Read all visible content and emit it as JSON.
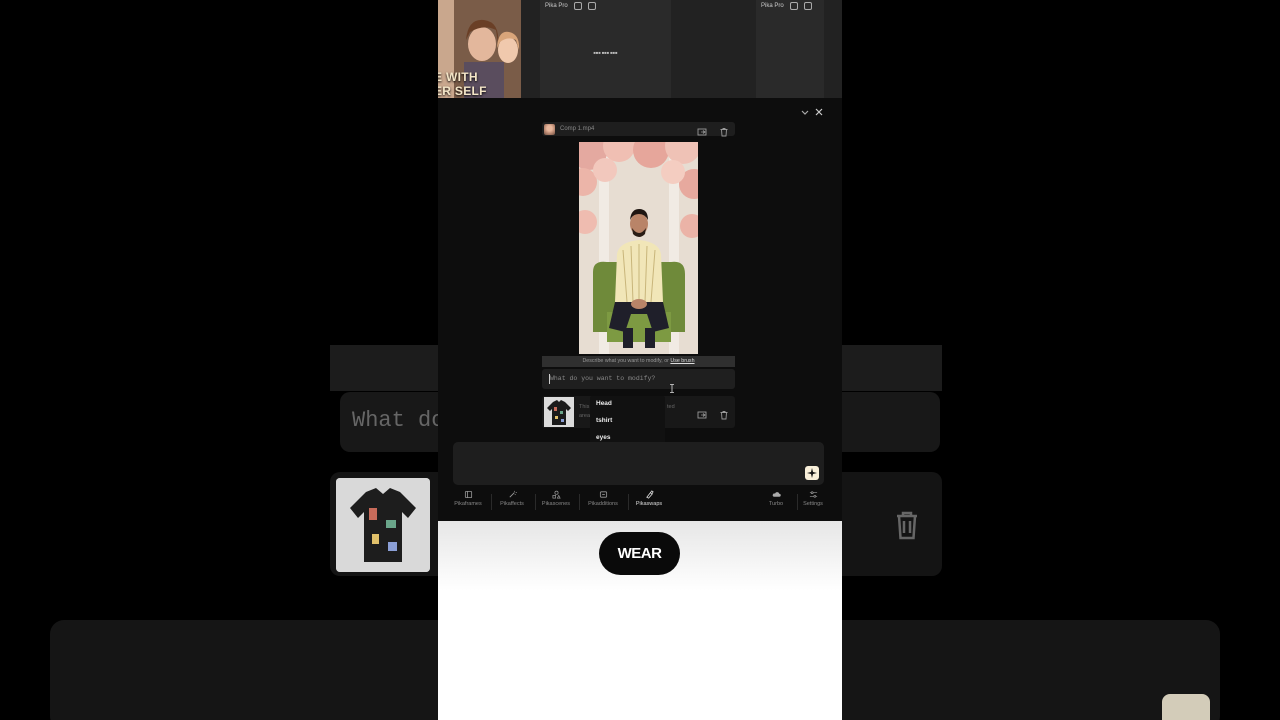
{
  "top_gallery": {
    "thumbnail_caption_line1": "E WITH",
    "thumbnail_caption_line2": "ER SELF",
    "card1_label": "Pika Pro",
    "card1_center": "■■■ ■■■ ■■■",
    "card2_label": "Pika Pro"
  },
  "editor": {
    "file_name": "Comp 1.mp4",
    "hint_text": "Describe what you want to modify, or ",
    "hint_link": "Use brush",
    "modify_placeholder": "What do you want to modify?",
    "swap_text_left": "This",
    "swap_text_left2": "area",
    "swap_text_right": "ted",
    "dropdown_options": [
      "Head",
      "tshirt",
      "eyes"
    ],
    "generate_icon": "sparkle-icon"
  },
  "nav": {
    "items": [
      {
        "label": "Pikaframes",
        "icon": "frames-icon",
        "active": false
      },
      {
        "label": "Pikaffects",
        "icon": "magic-wand-icon",
        "active": false
      },
      {
        "label": "Pikascenes",
        "icon": "shapes-icon",
        "active": false
      },
      {
        "label": "Pikadditions",
        "icon": "add-frame-icon",
        "active": false
      },
      {
        "label": "Pikaswaps",
        "icon": "brush-icon",
        "active": true
      }
    ],
    "right_items": [
      {
        "label": "Turbo",
        "icon": "cloud-icon"
      },
      {
        "label": "Settings",
        "icon": "sliders-icon"
      }
    ]
  },
  "caption": {
    "word": "WEAR"
  },
  "background_echo": {
    "input_text": "What do"
  },
  "colors": {
    "panel_bg": "#0d0d0d",
    "accent_button": "#f8efd9",
    "caption_pill": "#0a0a0a"
  }
}
